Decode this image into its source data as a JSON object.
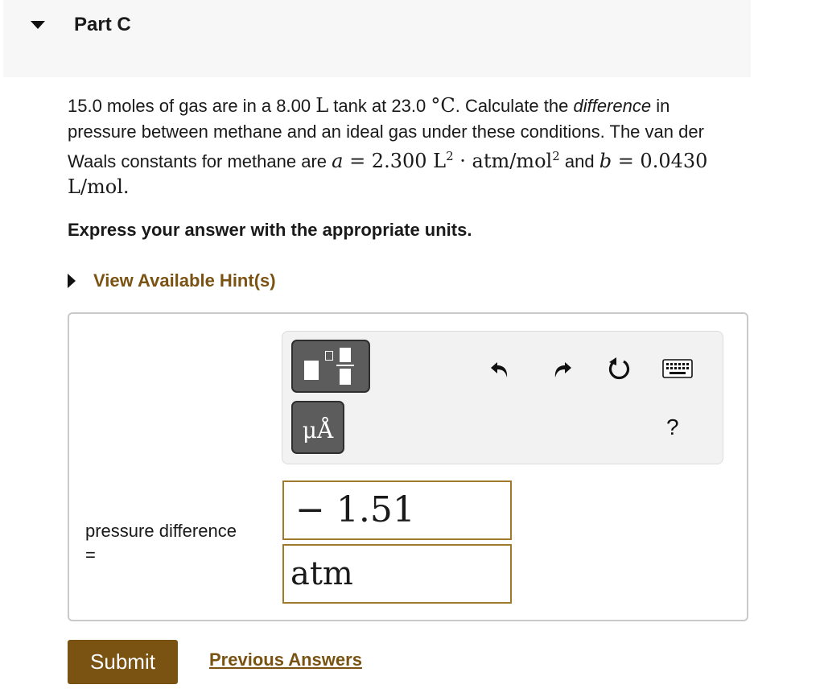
{
  "part": {
    "title": "Part C"
  },
  "question": {
    "text1": "15.0 moles of gas are in a 8.00 ",
    "unit_L": "L",
    "text2": " tank at 23.0 ",
    "unit_degC": "°C",
    "text3": ". Calculate the ",
    "emphasis": "difference",
    "text4": " in pressure between methane and an ideal gas under these conditions. The van der Waals constants for methane are ",
    "a_symbol": "a",
    "a_value": " = 2.300 L",
    "a_exp": "2",
    "a_unit": " · atm/mol",
    "a_unit_exp": "2",
    "and_text": " and ",
    "b_symbol": "b",
    "b_value": " = 0.0430 L/mol."
  },
  "instruction": "Express your answer with the appropriate units.",
  "hint_link": "View Available Hint(s)",
  "toolbar": {
    "units_button_label": "μÅ",
    "help_label": "?"
  },
  "answer": {
    "label": "pressure difference",
    "equals": "=",
    "value": "− 1.51",
    "unit": "atm"
  },
  "submit_label": "Submit",
  "previous_answers_label": "Previous Answers",
  "colors": {
    "accent": "#7a5211",
    "field_border": "#a07a2c",
    "header_bg": "#f7f7f7",
    "button_dark": "#5c5c5c"
  }
}
